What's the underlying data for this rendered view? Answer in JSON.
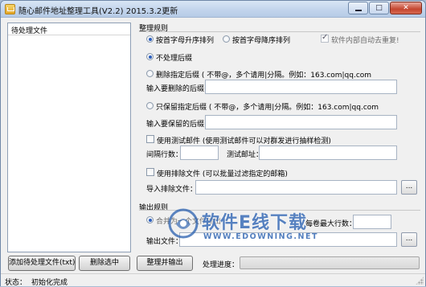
{
  "window": {
    "title": "随心邮件地址整理工具(V2.2)  2015.3.2更新"
  },
  "left_panel": {
    "list_header": "待处理文件",
    "add_button": "添加待处理文件(txt)",
    "remove_button": "删除选中"
  },
  "rules": {
    "group_title": "整理规则",
    "sort_asc": "按首字母升序排列",
    "sort_desc": "按首字母降序排列",
    "auto_dedupe": "软件内部自动去重复!",
    "no_suffix": "不处理后缀",
    "delete_suffix": "删除指定后缀 ( 不带@，多个请用|分隔。例如：163.com|qq.com",
    "delete_suffix_input_label": "输入要删除的后缀：",
    "delete_suffix_input_value": "",
    "keep_suffix": "只保留指定后缀 ( 不带@，多个请用|分隔。例如：163.com|qq.com",
    "keep_suffix_input_label": "输入要保留的后缀：",
    "keep_suffix_input_value": "",
    "test_mail": "使用测试邮件 (使用测试邮件可以对群发进行抽样检测)",
    "interval_label": "间隔行数：",
    "interval_value": "",
    "test_address_label": "测试邮址：",
    "test_address_value": "",
    "exclude_file": "使用排除文件 (可以批量过滤指定的邮箱)",
    "import_exclude_label": "导入排除文件：",
    "import_exclude_value": "",
    "browse": "..."
  },
  "output": {
    "group_title": "输出规则",
    "merge_option": "合并为一个文件输出",
    "max_lines_label": "每卷最大行数：",
    "max_lines_value": "",
    "output_file_label": "输出文件：",
    "output_file_value": "",
    "browse": "...",
    "run_button": "整理并输出",
    "progress_label": "处理进度：",
    "progress_fraction": 0
  },
  "status": {
    "label": "状态：",
    "text": "初始化完成"
  },
  "watermark": {
    "title": "软件E线下载",
    "url": "WWW.EDOWNING.NET"
  },
  "titlebar_buttons": {
    "minimize_icon": "minimize-icon",
    "maximize_icon": "maximize-icon",
    "close_icon": "close-icon"
  }
}
